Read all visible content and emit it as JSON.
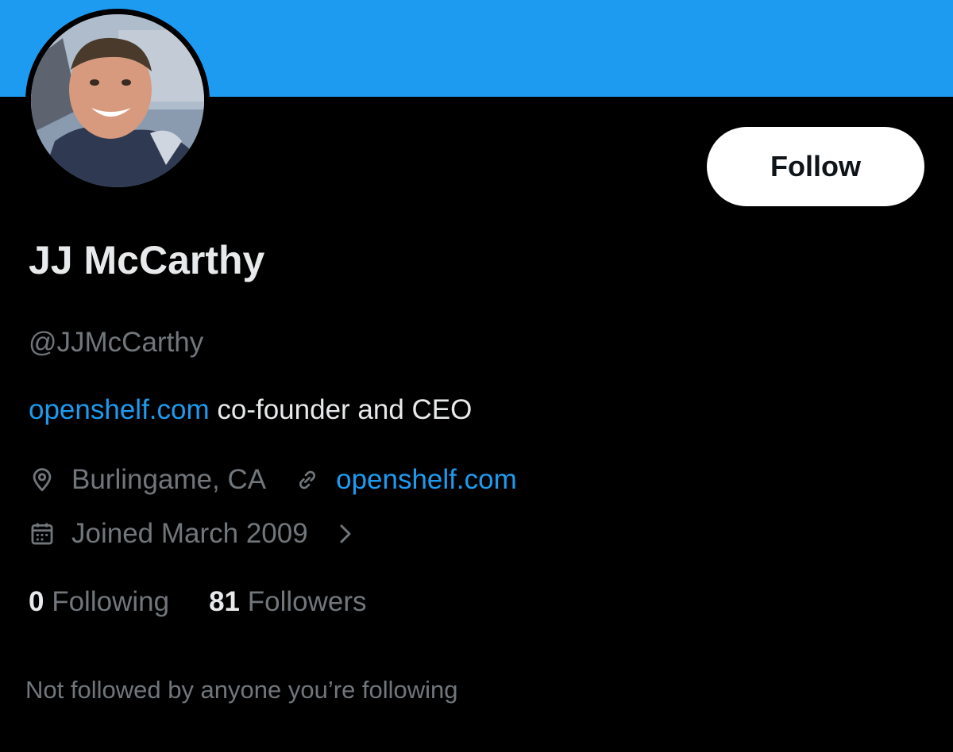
{
  "colors": {
    "banner": "#1d9bf0",
    "background": "#000000",
    "primary_text": "#e7e9ea",
    "secondary_text": "#71767b",
    "link": "#1d9bf0",
    "button_bg": "#ffffff",
    "button_text": "#0f1419"
  },
  "profile": {
    "display_name": "JJ McCarthy",
    "handle": "@JJMcCarthy",
    "bio_link": "openshelf.com",
    "bio_text": " co-founder and CEO",
    "location": "Burlingame, CA",
    "website": "openshelf.com",
    "joined": "Joined March 2009",
    "following_count": "0",
    "following_label": "Following",
    "followers_count": "81",
    "followers_label": "Followers",
    "not_followed_text": "Not followed by anyone you’re following"
  },
  "actions": {
    "follow_label": "Follow"
  },
  "icons": {
    "location": "location-pin-icon",
    "website": "link-icon",
    "joined": "calendar-icon",
    "joined_more": "chevron-right-icon"
  }
}
